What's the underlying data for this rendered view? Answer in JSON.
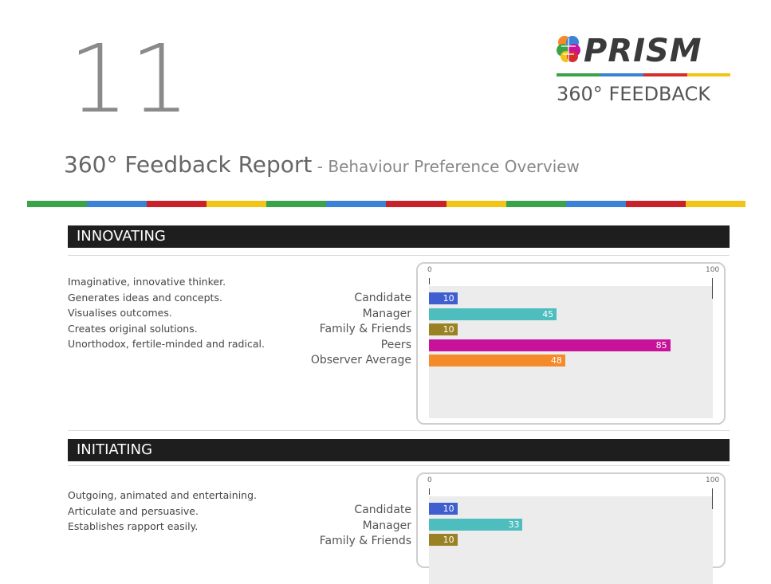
{
  "page": {
    "number": "11",
    "title_main": "360° Feedback Report",
    "title_sep": " - ",
    "title_sub": "Behaviour Preference Overview"
  },
  "logo": {
    "word": "PRISM",
    "subtitle": "360° FEEDBACK",
    "stripe_colors": [
      "#3aa34a",
      "#3b82d6",
      "#d62d2d",
      "#f2c418"
    ]
  },
  "stripe_colors": [
    "#3aa34a",
    "#3b82d6",
    "#c8222b",
    "#f2c418",
    "#3aa34a",
    "#3b82d6",
    "#c8222b",
    "#f2c418",
    "#3aa34a",
    "#3b82d6",
    "#c8222b",
    "#f2c418"
  ],
  "raters": [
    "Candidate",
    "Manager",
    "Family & Friends",
    "Peers",
    "Observer Average"
  ],
  "rater_colors": [
    "#3f5fd1",
    "#4dbdbd",
    "#9a8224",
    "#c8129a",
    "#f58a28"
  ],
  "sections": [
    {
      "heading": "INNOVATING",
      "descriptions": [
        "Imaginative, innovative thinker.",
        "Generates ideas and concepts.",
        "Visualises outcomes.",
        "Creates original solutions.",
        "Unorthodox, fertile-minded and radical."
      ],
      "scores": [
        10,
        45,
        10,
        85,
        48
      ]
    },
    {
      "heading": "INITIATING",
      "descriptions": [
        "Outgoing, animated and entertaining.",
        "Articulate and persuasive.",
        "Establishes rapport easily."
      ],
      "scores": [
        10,
        33,
        10
      ]
    }
  ],
  "chart_data": [
    {
      "type": "bar",
      "orientation": "horizontal",
      "title": "INNOVATING",
      "categories": [
        "Candidate",
        "Manager",
        "Family & Friends",
        "Peers",
        "Observer Average"
      ],
      "values": [
        10,
        45,
        10,
        85,
        48
      ],
      "xlim": [
        0,
        100
      ],
      "tick_labels": [
        "0",
        "100"
      ]
    },
    {
      "type": "bar",
      "orientation": "horizontal",
      "title": "INITIATING",
      "categories": [
        "Candidate",
        "Manager",
        "Family & Friends"
      ],
      "values": [
        10,
        33,
        10
      ],
      "xlim": [
        0,
        100
      ],
      "tick_labels": [
        "0",
        "100"
      ]
    }
  ]
}
